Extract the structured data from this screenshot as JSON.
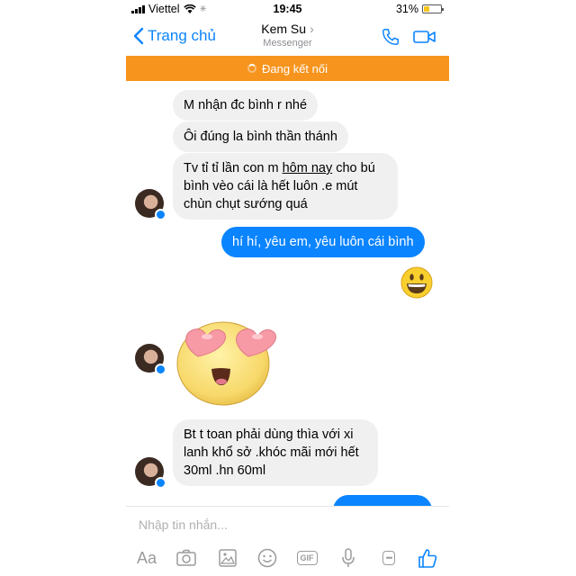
{
  "status_bar": {
    "carrier": "Viettel",
    "time": "19:45",
    "battery": "31%",
    "battery_level": 0.31
  },
  "header": {
    "back_label": "Trang chủ",
    "contact_name": "Kem Su",
    "contact_chevron": "›",
    "app_name": "Messenger"
  },
  "connection": {
    "text": "Đang kết nối"
  },
  "messages": [
    {
      "side": "in",
      "text": "M nhận đc bình r nhé"
    },
    {
      "side": "in",
      "text": "Ôi đúng la bình thần thánh"
    },
    {
      "side": "in",
      "line1_pre": "Tv tỉ tỉ lần con m ",
      "line1_link": "hôm nay",
      "line1_post": " cho bú",
      "line2": "bình vèo cái là hết luôn .e mút",
      "line3": "chùn chụt sướng quá"
    },
    {
      "side": "out",
      "text": "hí hí, yêu em, yêu luôn cái bình"
    },
    {
      "side": "out",
      "type": "emoji",
      "name": "grinning-face"
    },
    {
      "side": "in",
      "type": "sticker",
      "name": "heart-eyes-face"
    },
    {
      "side": "in",
      "line1": "Bt t toan phải dùng thìa với xi",
      "line2": "lanh khổ sở .khóc mãi mới hết",
      "line3": "30ml .hn 60ml"
    }
  ],
  "composer": {
    "placeholder": "Nhập tin nhắn...",
    "text_format_label": "Aa",
    "gif_label": "GIF",
    "more_label": "•••"
  },
  "colors": {
    "accent": "#0a84ff",
    "connection_bar": "#f7941d",
    "incoming_bubble": "#f1f0f0"
  }
}
